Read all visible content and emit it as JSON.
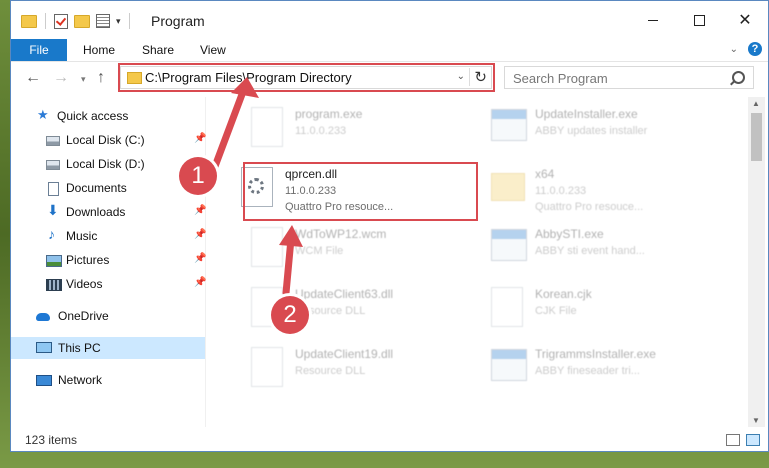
{
  "window": {
    "title": "Program"
  },
  "ribbon": {
    "tabs": [
      "File",
      "Home",
      "Share",
      "View"
    ]
  },
  "address": {
    "path": "C:\\Program Files\\Program Directory"
  },
  "search": {
    "placeholder": "Search Program"
  },
  "sidebar": {
    "items": [
      {
        "label": "Quick access",
        "icon": "star-icon"
      },
      {
        "label": "Local Disk (C:)",
        "icon": "disk-icon",
        "pinned": true
      },
      {
        "label": "Local Disk (D:)",
        "icon": "disk-icon"
      },
      {
        "label": "Documents",
        "icon": "documents-icon",
        "pinned": true
      },
      {
        "label": "Downloads",
        "icon": "download-icon",
        "pinned": true
      },
      {
        "label": "Music",
        "icon": "music-icon",
        "pinned": true
      },
      {
        "label": "Pictures",
        "icon": "pictures-icon",
        "pinned": true
      },
      {
        "label": "Videos",
        "icon": "videos-icon",
        "pinned": true
      },
      {
        "label": "OneDrive",
        "icon": "cloud-icon"
      },
      {
        "label": "This PC",
        "icon": "computer-icon",
        "selected": true
      },
      {
        "label": "Network",
        "icon": "network-icon"
      }
    ]
  },
  "files": [
    {
      "name": "program.exe",
      "line1": "11.0.0.233",
      "line2": "",
      "icon": "program-icon"
    },
    {
      "name": "UpdateInstaller.exe",
      "line1": "ABBY updates installer",
      "line2": "",
      "icon": "exe-icon"
    },
    {
      "name": "qprcen.dll",
      "line1": "11.0.0.233",
      "line2": "Quattro Pro resouce...",
      "icon": "dll-icon"
    },
    {
      "name": "x64",
      "line1": "11.0.0.233",
      "line2": "Quattro Pro resouce...",
      "icon": "folder-icon"
    },
    {
      "name": "WdToWP12.wcm",
      "line1": "WCM File",
      "line2": "",
      "icon": "file-icon"
    },
    {
      "name": "AbbySTI.exe",
      "line1": "ABBY sti event hand...",
      "line2": "",
      "icon": "exe-icon"
    },
    {
      "name": "UpdateClient63.dll",
      "line1": "Resource DLL",
      "line2": "",
      "icon": "dll-icon"
    },
    {
      "name": "Korean.cjk",
      "line1": "CJK File",
      "line2": "",
      "icon": "file-icon"
    },
    {
      "name": "UpdateClient19.dll",
      "line1": "Resource DLL",
      "line2": "",
      "icon": "dll-icon"
    },
    {
      "name": "TrigrammsInstaller.exe",
      "line1": "ABBY fineseader tri...",
      "line2": "",
      "icon": "exe-icon"
    }
  ],
  "status": {
    "items": "123 items"
  },
  "callouts": [
    "1",
    "2"
  ],
  "colors": {
    "accent": "#1979ca",
    "highlight": "#d94a50",
    "selected": "#cce8ff"
  }
}
